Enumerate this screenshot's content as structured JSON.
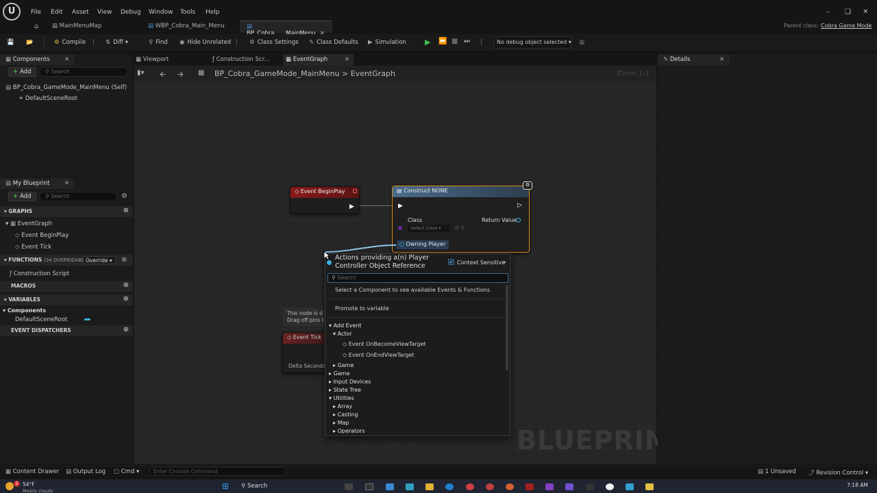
{
  "menu": [
    "File",
    "Edit",
    "Asset",
    "View",
    "Debug",
    "Window",
    "Tools",
    "Help"
  ],
  "tabs": {
    "project": "MainMenuMap",
    "widget": "WBP_Cobra_Main_Menu",
    "blueprint": "BP_Cobra_..._MainMenu"
  },
  "parent_class": {
    "label": "Parent class:",
    "value": "Cobra Game Mode"
  },
  "toolbar": {
    "compile": "Compile",
    "diff": "Diff",
    "find": "Find",
    "hide_unrelated": "Hide Unrelated",
    "class_settings": "Class Settings",
    "class_defaults": "Class Defaults",
    "simulation": "Simulation",
    "debug_object": "No debug object selected"
  },
  "components_panel": {
    "title": "Components",
    "add": "Add",
    "search_placeholder": "Search",
    "items": [
      "BP_Cobra_GameMode_MainMenu (Self)",
      "DefaultSceneRoot"
    ]
  },
  "editor_tabs": {
    "viewport": "Viewport",
    "construction": "Construction Scr...",
    "eventgraph": "EventGraph"
  },
  "breadcrumb": {
    "root": "BP_Cobra_GameMode_MainMenu",
    "sep": ">",
    "leaf": "EventGraph"
  },
  "zoom": "Zoom 1:1",
  "my_blueprint": {
    "title": "My Blueprint",
    "add": "Add",
    "search_placeholder": "Search",
    "graphs": "GRAPHS",
    "graph_items": [
      "EventGraph",
      "Event BeginPlay",
      "Event Tick"
    ],
    "functions": "FUNCTIONS",
    "functions_count": "(34 OVERRIDABLE)",
    "override": "Override",
    "function_items": [
      "Construction Script"
    ],
    "macros": "MACROS",
    "variables": "VARIABLES",
    "var_category": "Components",
    "var_items": [
      "DefaultSceneRoot"
    ],
    "dispatchers": "EVENT DISPATCHERS"
  },
  "details": {
    "title": "Details"
  },
  "nodes": {
    "begin_play": "Event BeginPlay",
    "construct_title": "Construct NONE",
    "class_label": "Class",
    "select_class": "Select Class",
    "return_value": "Return Value",
    "owning_player": "Owning Player",
    "comment_line1": "This node is d",
    "comment_line2": "Drag off pins t",
    "event_tick": "Event Tick",
    "delta_seconds": "Delta Seconds"
  },
  "context_menu": {
    "title_line1": "Actions providing a(n) Player",
    "title_line2": "Controller Object Reference",
    "context_sensitive": "Context Sensitive",
    "search_placeholder": "Search",
    "hint": "Select a Component to see available Events & Functions",
    "promote": "Promote to variable",
    "add_event": "Add Event",
    "actor": "Actor",
    "actor_items": [
      "Event OnBecomeViewTarget",
      "Event OnEndViewTarget"
    ],
    "categories_a": [
      "Game"
    ],
    "categories_b": [
      "Game",
      "Input Devices",
      "State Tree",
      "Utilities"
    ],
    "utilities_sub": [
      "Array",
      "Casting",
      "Map",
      "Operators"
    ]
  },
  "watermark": "BLUEPRINT",
  "statusbar": {
    "content_drawer": "Content Drawer",
    "output_log": "Output Log",
    "cmd": "Cmd",
    "console_placeholder": "Enter Console Command",
    "unsaved": "1 Unsaved",
    "revision": "Revision Control"
  },
  "taskbar": {
    "temp": "54°F",
    "weather": "Mostly cloudy",
    "search": "Search",
    "time": "7:18 AM",
    "badge": "2"
  },
  "colors": {
    "exec_red": "#8a1a1a",
    "construct_blue": "#4a6b8a",
    "accent_green": "#3fbf4f",
    "selected_orange": "#e08a1a"
  }
}
